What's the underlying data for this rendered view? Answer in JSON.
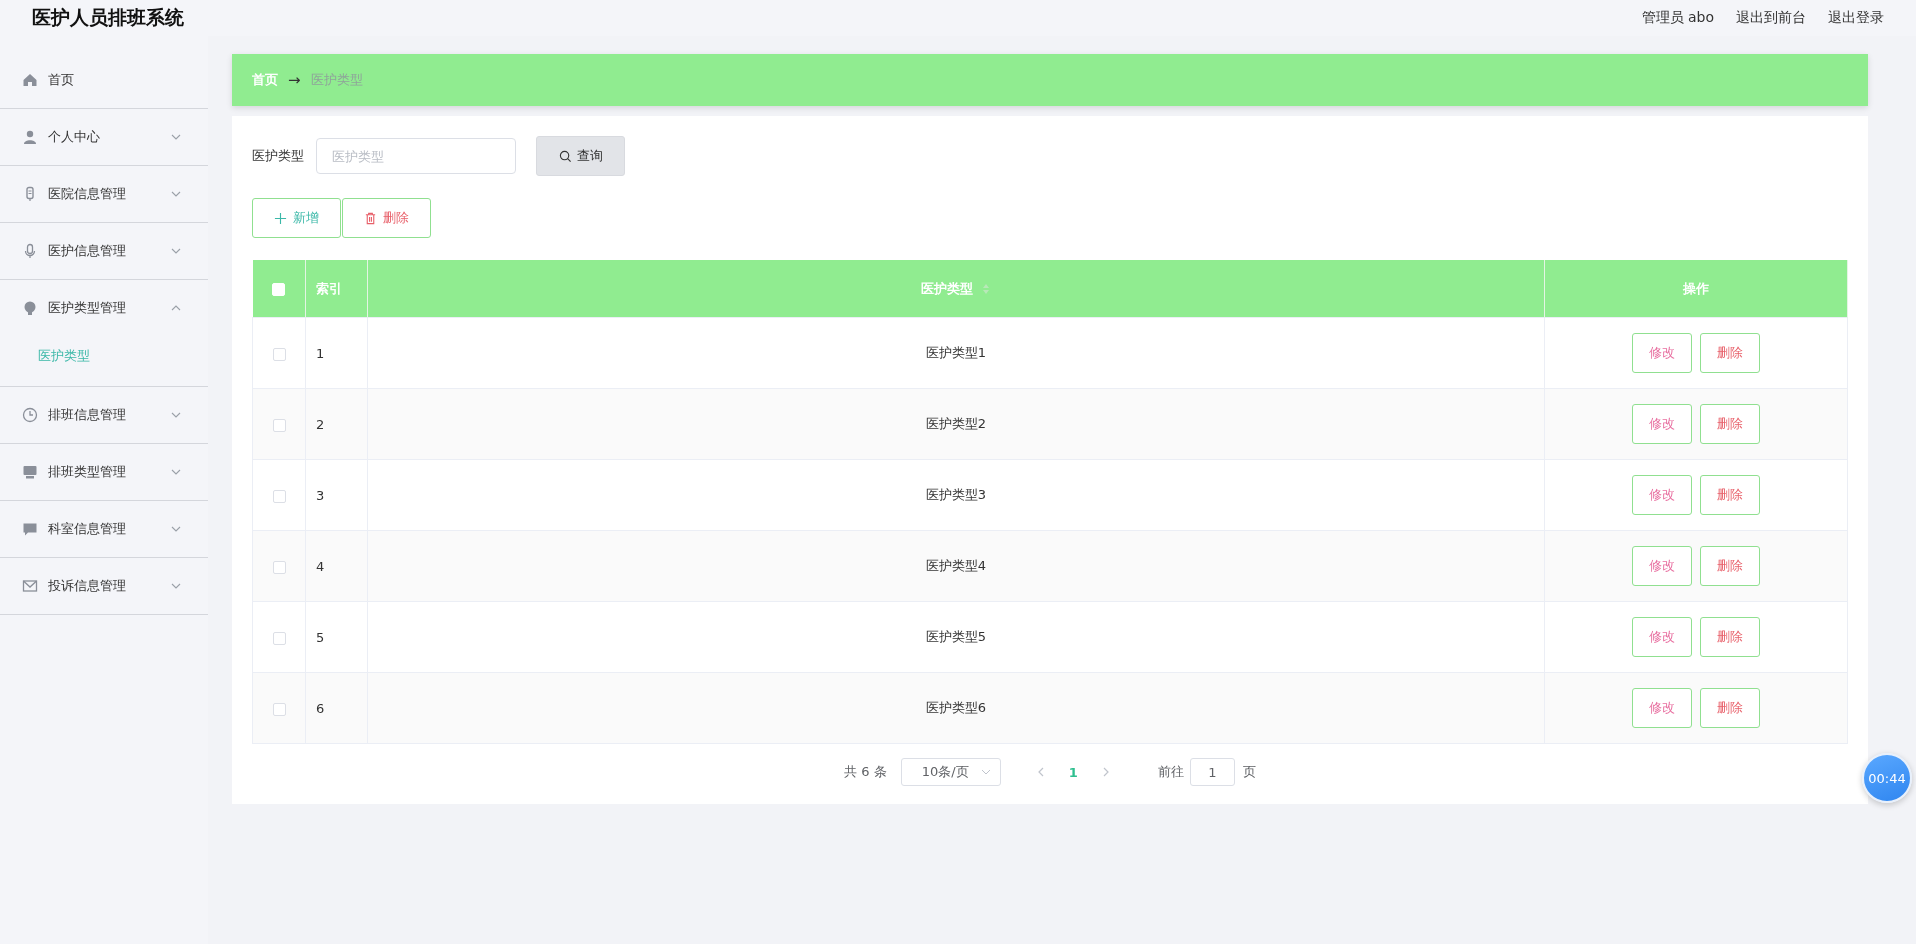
{
  "header": {
    "title": "医护人员排班系统",
    "user": "管理员 abo",
    "links": [
      "退出到前台",
      "退出登录"
    ]
  },
  "sidebar": {
    "items": [
      {
        "label": "首页"
      },
      {
        "label": "个人中心",
        "expanded": false
      },
      {
        "label": "医院信息管理",
        "expanded": false
      },
      {
        "label": "医护信息管理",
        "expanded": false
      },
      {
        "label": "医护类型管理",
        "expanded": true,
        "children": [
          {
            "label": "医护类型",
            "selected": true
          }
        ]
      },
      {
        "label": "排班信息管理",
        "expanded": false
      },
      {
        "label": "排班类型管理",
        "expanded": false
      },
      {
        "label": "科室信息管理",
        "expanded": false
      },
      {
        "label": "投诉信息管理",
        "expanded": false
      }
    ]
  },
  "breadcrumb": {
    "items": [
      "首页",
      "医护类型"
    ],
    "separator": "→"
  },
  "search": {
    "label": "医护类型",
    "placeholder": "医护类型",
    "button": "查询"
  },
  "actions": {
    "add": "新增",
    "delete": "删除"
  },
  "table": {
    "select_all_checked": false,
    "columns": [
      "索引",
      "医护类型",
      "操作"
    ],
    "rows": [
      {
        "index": "1",
        "type": "医护类型1",
        "checked": false,
        "edit": "修改",
        "delete": "删除"
      },
      {
        "index": "2",
        "type": "医护类型2",
        "checked": false,
        "edit": "修改",
        "delete": "删除"
      },
      {
        "index": "3",
        "type": "医护类型3",
        "checked": false,
        "edit": "修改",
        "delete": "删除"
      },
      {
        "index": "4",
        "type": "医护类型4",
        "checked": false,
        "edit": "修改",
        "delete": "删除"
      },
      {
        "index": "5",
        "type": "医护类型5",
        "checked": false,
        "edit": "修改",
        "delete": "删除"
      },
      {
        "index": "6",
        "type": "医护类型6",
        "checked": false,
        "edit": "修改",
        "delete": "删除"
      }
    ]
  },
  "pagination": {
    "total": "共 6 条",
    "page_size": "10条/页",
    "pages": [
      {
        "label": "1",
        "selected": true
      }
    ],
    "goto_label": "前往",
    "goto_value": "1",
    "goto_suffix": "页"
  },
  "timer": "00:44"
}
